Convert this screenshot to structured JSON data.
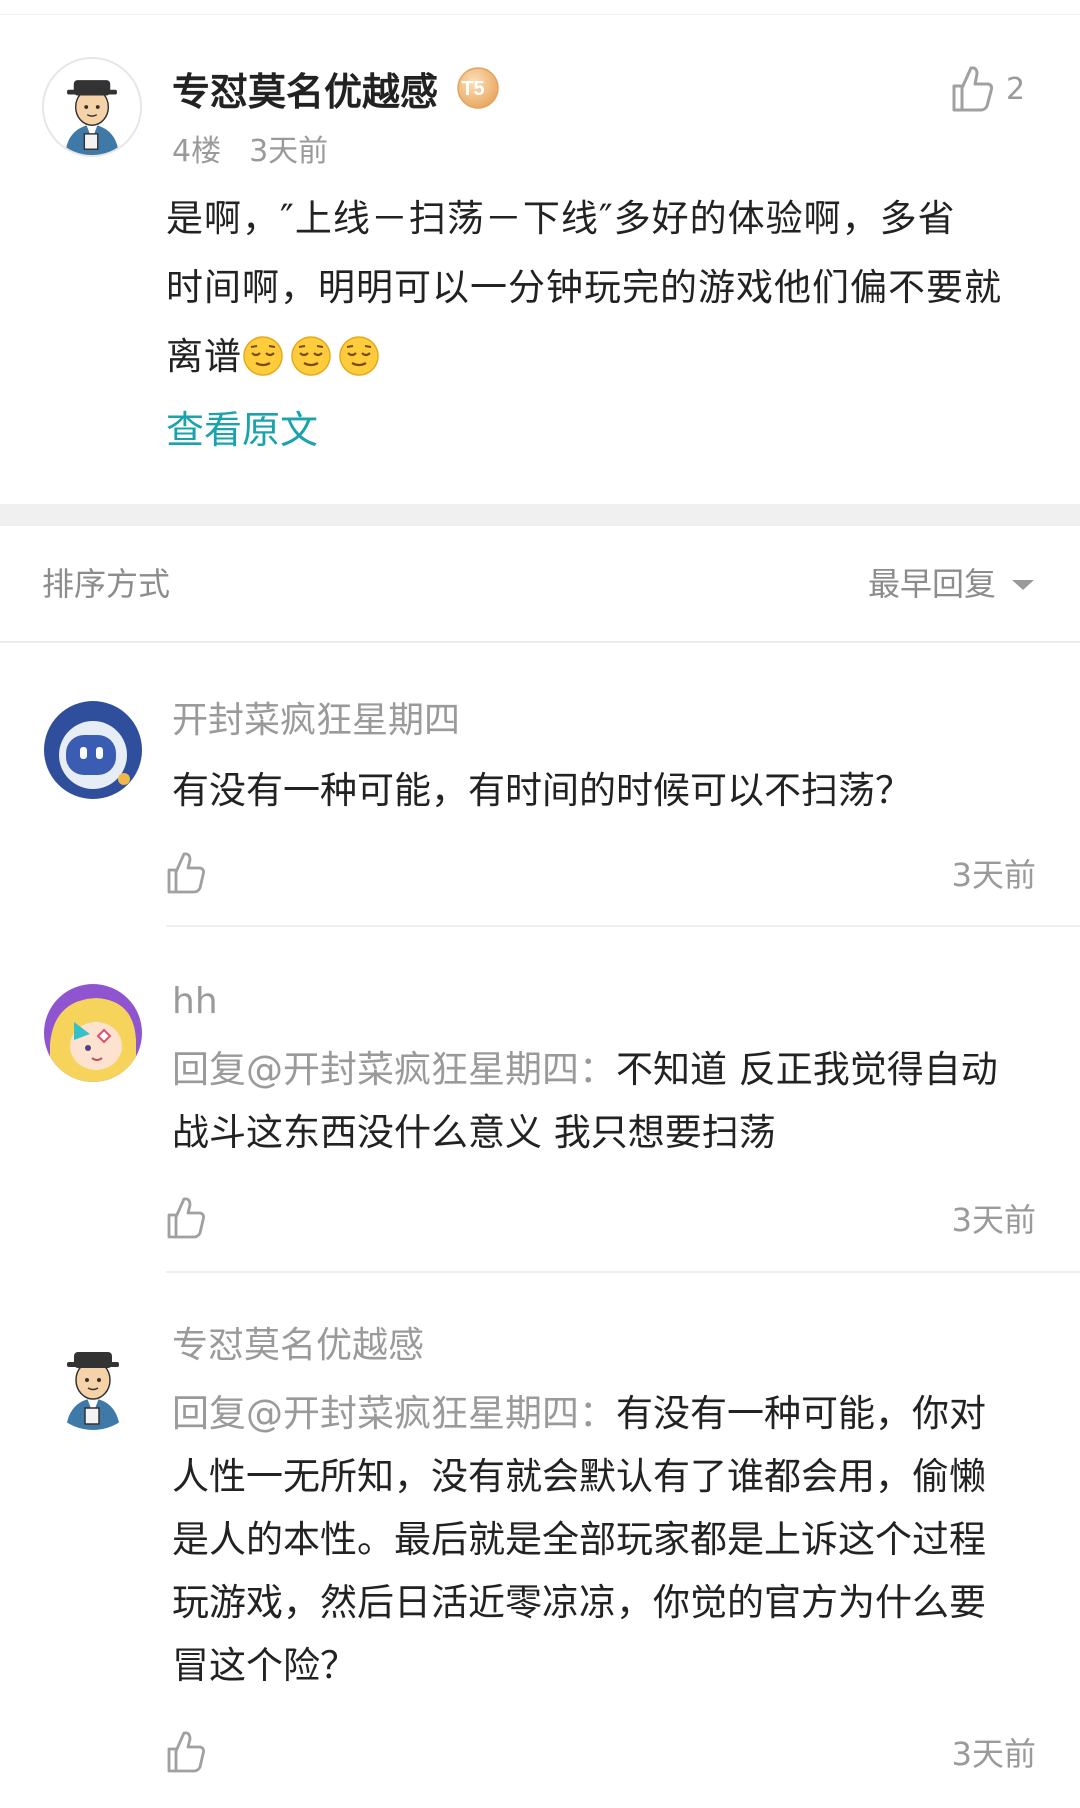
{
  "main_post": {
    "author": "专怼莫名优越感",
    "badge": "T5",
    "floor": "4楼",
    "time": "3天前",
    "like_count": "2",
    "body_lines": [
      "是啊，″上线－扫荡－下线″多好的体验啊，多省",
      "时间啊，明明可以一分钟玩完的游戏他们偏不要就",
      "离谱"
    ],
    "emojis": [
      "relieved-face",
      "relieved-face",
      "relieved-face"
    ],
    "view_original": "查看原文"
  },
  "sort": {
    "label": "排序方式",
    "value": "最早回复"
  },
  "replies": [
    {
      "author": "开封菜疯狂星期四",
      "lines": [
        "有没有一种可能，有时间的时候可以不扫荡？"
      ],
      "time": "3天前"
    },
    {
      "author": "hh",
      "mention": "回复@开封菜疯狂星期四：",
      "lines": [
        "不知道  反正我觉得自动",
        "战斗这东西没什么意义  我只想要扫荡"
      ],
      "time": "3天前"
    },
    {
      "author": "专怼莫名优越感",
      "mention": "回复@开封菜疯狂星期四：",
      "lines": [
        "有没有一种可能，你对",
        "人性一无所知，没有就会默认有了谁都会用，偷懒",
        "是人的本性。最后就是全部玩家都是上诉这个过程",
        "玩游戏，然后日活近零凉凉，你觉的官方为什么要",
        "冒这个险？"
      ],
      "time": "3天前"
    }
  ]
}
